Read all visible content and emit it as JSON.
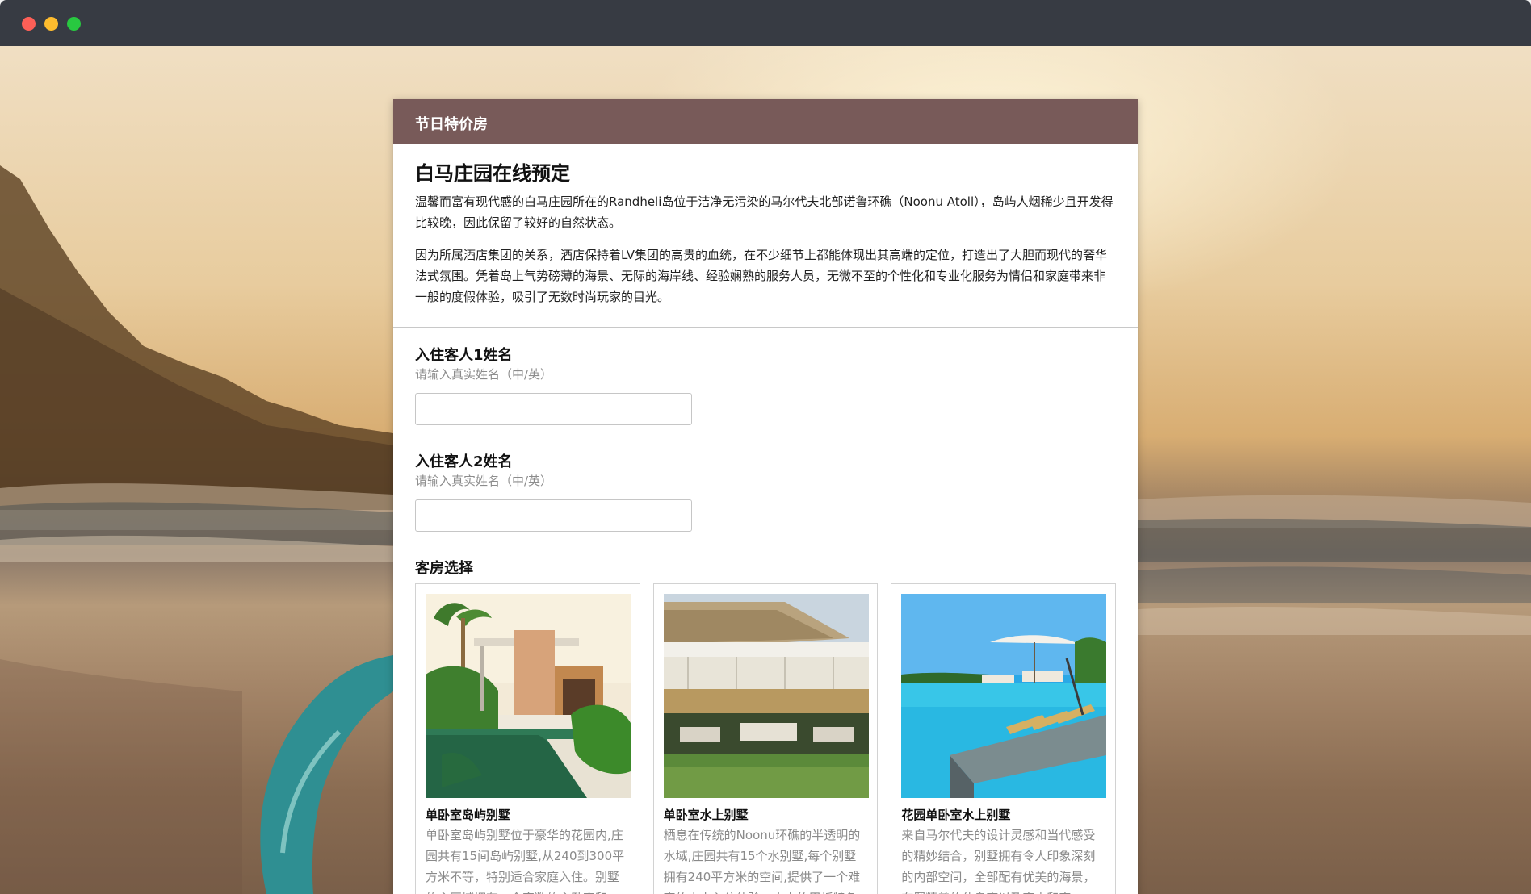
{
  "window": {
    "buttons": [
      "close",
      "minimize",
      "zoom"
    ]
  },
  "form": {
    "header_title": "节日特价房",
    "title": "白马庄园在线预定",
    "intro_paragraphs": [
      "温馨而富有现代感的白马庄园所在的Randheli岛位于洁净无污染的马尔代夫北部诺鲁环礁（Noonu Atoll），岛屿人烟稀少且开发得比较晚，因此保留了较好的自然状态。",
      "因为所属酒店集团的关系，酒店保持着LV集团的高贵的血统，在不少细节上都能体现出其高端的定位，打造出了大胆而现代的奢华法式氛围。凭着岛上气势磅薄的海景、无际的海岸线、经验娴熟的服务人员，无微不至的个性化和专业化服务为情侣和家庭带来非一般的度假体验，吸引了无数时尚玩家的目光。"
    ],
    "fields": [
      {
        "label": "入住客人1姓名",
        "hint": "请输入真实姓名（中/英）",
        "value": ""
      },
      {
        "label": "入住客人2姓名",
        "hint": "请输入真实姓名（中/英）",
        "value": ""
      }
    ],
    "room_section_label": "客房选择",
    "rooms": [
      {
        "name": "单卧室岛屿别墅",
        "description": "单卧室岛屿别墅位于豪华的花园内,庄园共有15间岛屿别墅,从240到300平方米不等，特别适合家庭入住。别墅的主区域拥有一个宽敞的主卧室和",
        "image": "island-villa-photo"
      },
      {
        "name": "单卧室水上别墅",
        "description": "栖息在传统的Noonu环礁的半透明的水域,庄园共有15个水别墅,每个别墅拥有240平方米的空间,提供了一个难忘的水上入住体验。水上的甲板特色",
        "image": "water-villa-photo"
      },
      {
        "name": "花园单卧室水上别墅",
        "description": "来自马尔代夫的设计灵感和当代感受的精妙结合，别墅拥有令人印象深刻的内部空间，全部配有优美的海景，布置精美的休息室以及室内和室",
        "image": "garden-water-villa-photo"
      }
    ]
  },
  "background": {
    "image": "sunset-beach-surfboard-photo"
  }
}
